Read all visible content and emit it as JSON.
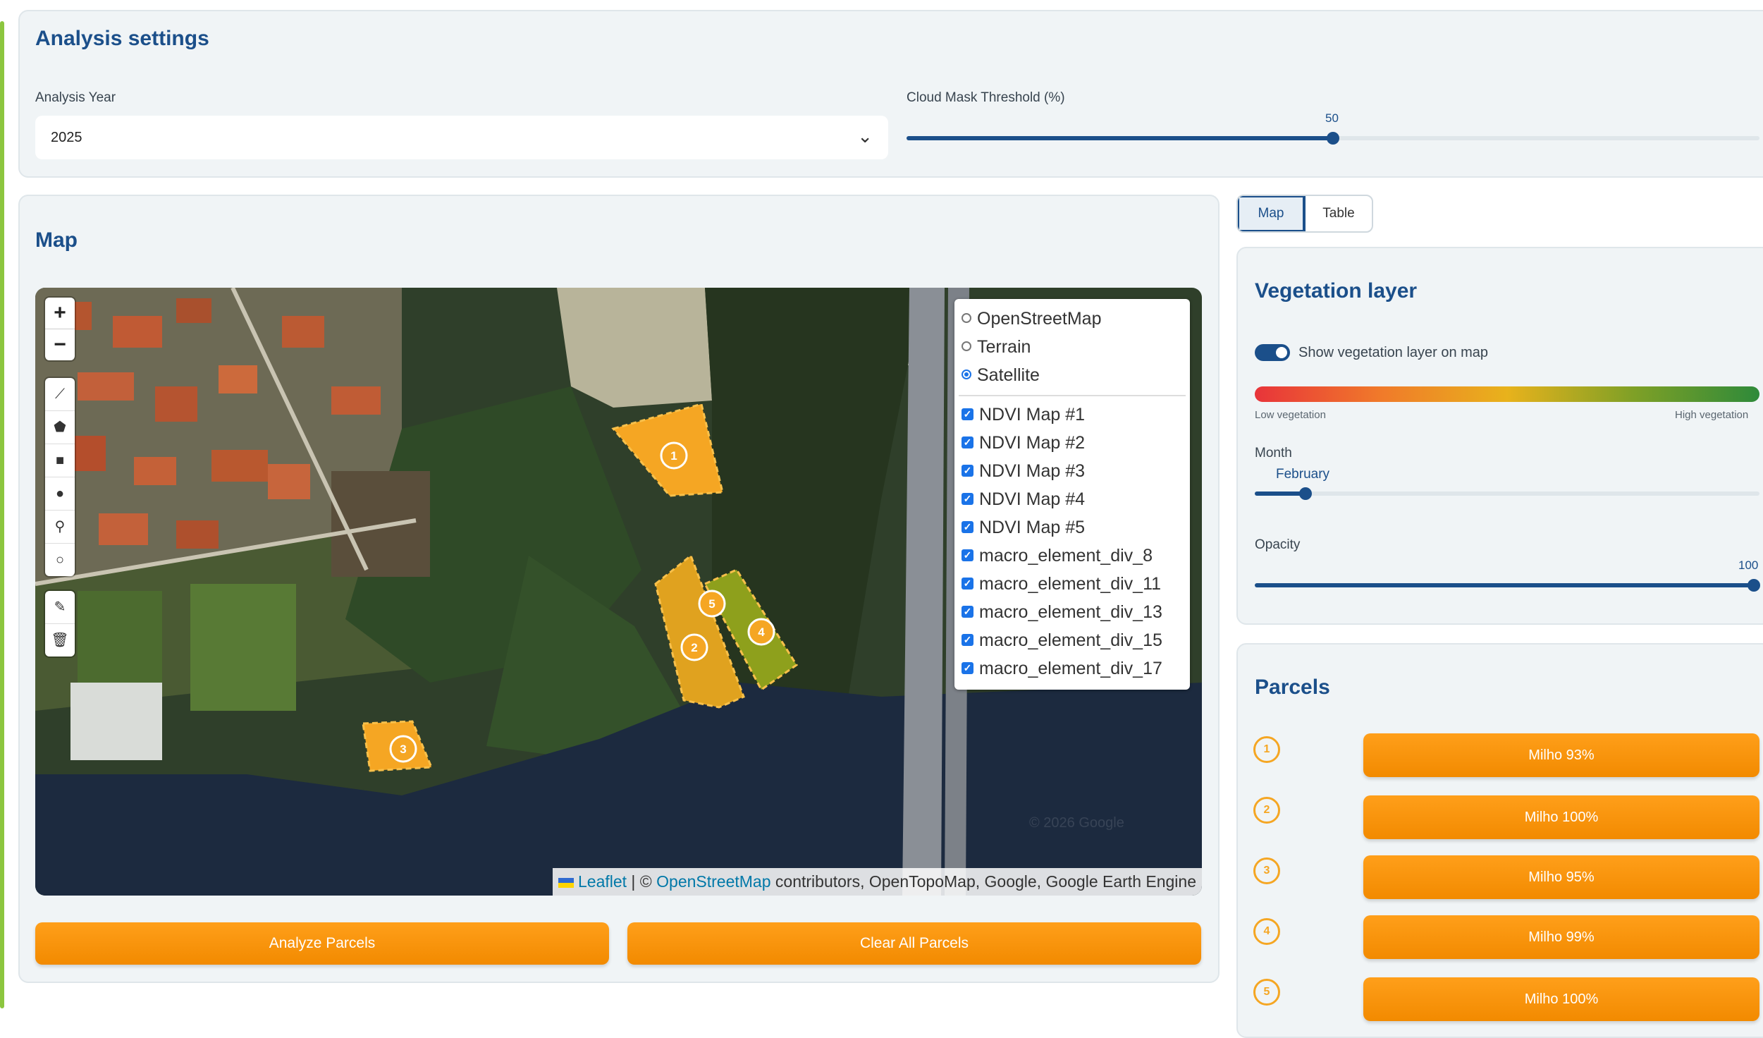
{
  "settings": {
    "title": "Analysis settings",
    "year_label": "Analysis Year",
    "year_value": "2025",
    "cloud_label": "Cloud Mask Threshold (%)",
    "cloud_value": "50",
    "cloud_fraction": 0.5
  },
  "map": {
    "title": "Map",
    "zoom_in": "+",
    "zoom_out": "−",
    "base_layers": [
      {
        "label": "OpenStreetMap",
        "selected": false
      },
      {
        "label": "Terrain",
        "selected": false
      },
      {
        "label": "Satellite",
        "selected": true
      }
    ],
    "overlays": [
      {
        "label": "NDVI Map #1",
        "checked": true
      },
      {
        "label": "NDVI Map #2",
        "checked": true
      },
      {
        "label": "NDVI Map #3",
        "checked": true
      },
      {
        "label": "NDVI Map #4",
        "checked": true
      },
      {
        "label": "NDVI Map #5",
        "checked": true
      },
      {
        "label": "macro_element_div_8",
        "checked": true
      },
      {
        "label": "macro_element_div_11",
        "checked": true
      },
      {
        "label": "macro_element_div_13",
        "checked": true
      },
      {
        "label": "macro_element_div_15",
        "checked": true
      },
      {
        "label": "macro_element_div_17",
        "checked": true
      }
    ],
    "parcel_markers": [
      "1",
      "2",
      "3",
      "4",
      "5"
    ],
    "watermark": "© 2026 Google",
    "attribution": {
      "leaflet": "Leaflet",
      "separator": " | © ",
      "osm": "OpenStreetMap",
      "rest": " contributors, OpenTopoMap, Google, Google Earth Engine"
    }
  },
  "buttons": {
    "analyze": "Analyze Parcels",
    "clear": "Clear All Parcels"
  },
  "tabs": [
    {
      "label": "Map",
      "active": true
    },
    {
      "label": "Table",
      "active": false
    }
  ],
  "vegetation": {
    "title": "Vegetation layer",
    "toggle_label": "Show vegetation layer on map",
    "toggle_on": true,
    "low_label": "Low vegetation",
    "high_label": "High vegetation",
    "month_label": "Month",
    "month_value": "February",
    "opacity_label": "Opacity",
    "opacity_value": "100"
  },
  "parcels": {
    "title": "Parcels",
    "items": [
      {
        "num": "1",
        "label": "Milho 93%"
      },
      {
        "num": "2",
        "label": "Milho 100%"
      },
      {
        "num": "3",
        "label": "Milho 95%"
      },
      {
        "num": "4",
        "label": "Milho 99%"
      },
      {
        "num": "5",
        "label": "Milho 100%"
      }
    ]
  },
  "colors": {
    "accent": "#1b4f8a",
    "orange": "#f28a00",
    "panel": "#f0f4f6",
    "left_bar": "#8cc63f"
  }
}
